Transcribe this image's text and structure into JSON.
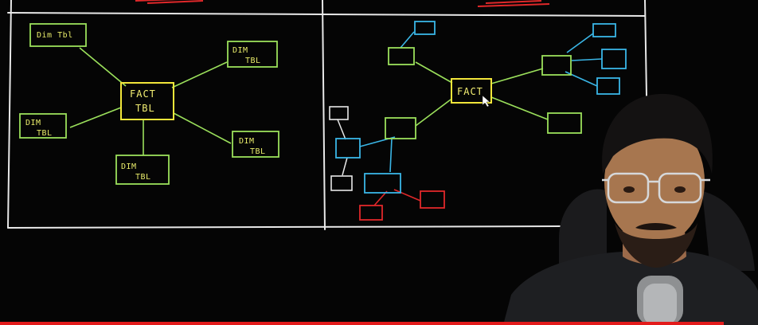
{
  "colors": {
    "background": "#050505",
    "chalk_white": "#e8e8e8",
    "dim_green": "#9be05b",
    "fact_yellow": "#f2e63a",
    "snowflake_blue": "#3ab6e6",
    "snowflake_red": "#e0282a",
    "progress_red": "#e31b1b"
  },
  "left_diagram": {
    "fact_label_line1": "FACT",
    "fact_label_line2": "TBL",
    "dim_top_left": "Dim Tbl",
    "dim_top_right_line1": "DIM",
    "dim_top_right_line2": "TBL",
    "dim_left_line1": "DIM",
    "dim_left_line2": "TBL",
    "dim_bottom_line1": "DIM",
    "dim_bottom_line2": "TBL",
    "dim_right_line1": "DIM",
    "dim_right_line2": "TBL"
  },
  "right_diagram": {
    "fact_label": "FACT"
  },
  "player": {
    "progress": 0.955
  }
}
